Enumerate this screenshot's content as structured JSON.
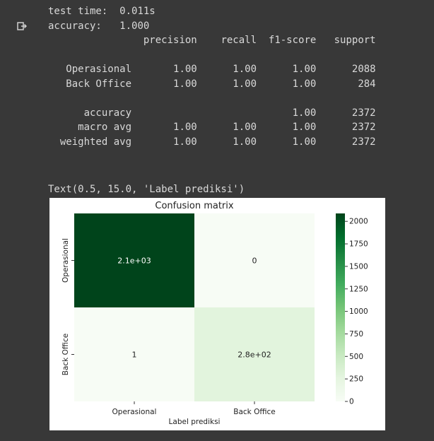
{
  "output_icon": "output-arrow-icon",
  "log": {
    "test_time_label": "test time:",
    "test_time_value": "0.011s",
    "accuracy_label": "accuracy:",
    "accuracy_value": "1.000"
  },
  "report": {
    "headers": [
      "precision",
      "recall",
      "f1-score",
      "support"
    ],
    "rows": [
      {
        "label": "Operasional",
        "precision": "1.00",
        "recall": "1.00",
        "f1": "1.00",
        "support": "2088"
      },
      {
        "label": "Back Office",
        "precision": "1.00",
        "recall": "1.00",
        "f1": "1.00",
        "support": "284"
      }
    ],
    "summary": [
      {
        "label": "accuracy",
        "precision": "",
        "recall": "",
        "f1": "1.00",
        "support": "2372"
      },
      {
        "label": "macro avg",
        "precision": "1.00",
        "recall": "1.00",
        "f1": "1.00",
        "support": "2372"
      },
      {
        "label": "weighted avg",
        "precision": "1.00",
        "recall": "1.00",
        "f1": "1.00",
        "support": "2372"
      }
    ]
  },
  "text_repr": "Text(0.5, 15.0, 'Label prediksi')",
  "chart_data": {
    "type": "heatmap",
    "title": "Confusion matrix",
    "xlabel": "Label prediksi",
    "ylabel": "",
    "x_categories": [
      "Operasional",
      "Back Office"
    ],
    "y_categories": [
      "Operasional",
      "Back Office"
    ],
    "values": [
      [
        2088,
        0
      ],
      [
        1,
        284
      ]
    ],
    "annotations": [
      [
        "2.1e+03",
        "0"
      ],
      [
        "1",
        "2.8e+02"
      ]
    ],
    "colorbar": {
      "min": 0,
      "max": 2088,
      "ticks": [
        0,
        250,
        500,
        750,
        1000,
        1250,
        1500,
        1750,
        2000
      ],
      "colormap": "Greens"
    },
    "colors": {
      "high": "#00441b",
      "low": "#f7fcf5",
      "mid_low": "#e6f4e1"
    }
  }
}
